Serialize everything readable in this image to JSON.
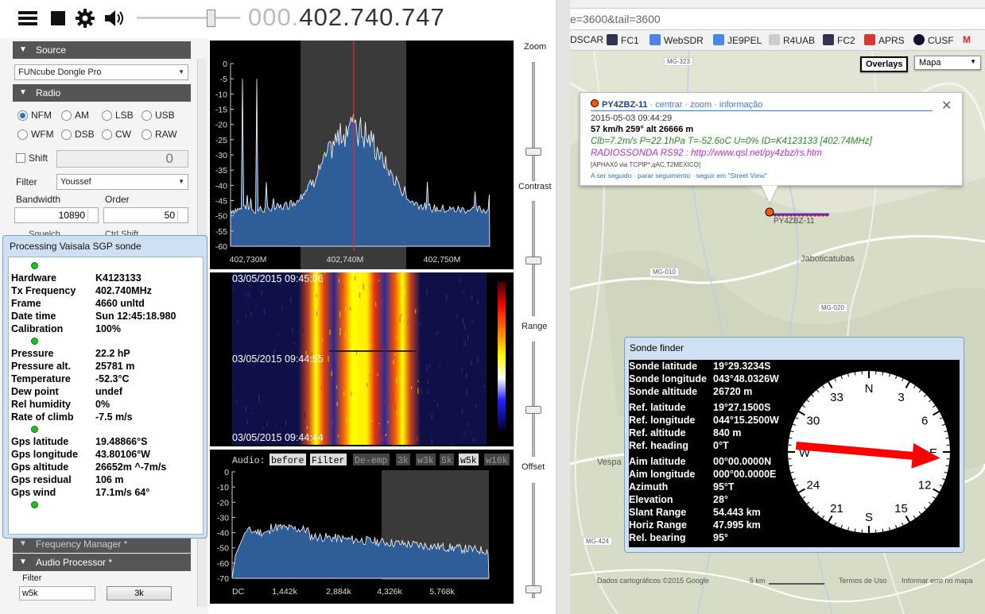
{
  "toolbar": {
    "freq_dim": "000.",
    "freq_main": "402.740.747",
    "icons": [
      "menu-icon",
      "stop-icon",
      "gear-icon",
      "speaker-icon"
    ]
  },
  "sidebar": {
    "source": {
      "title": "Source",
      "device": "FUNcube Dongle Pro"
    },
    "radio": {
      "title": "Radio",
      "modes": [
        "NFM",
        "AM",
        "LSB",
        "USB",
        "WFM",
        "DSB",
        "CW",
        "RAW"
      ],
      "selected": "NFM",
      "shift_label": "Shift",
      "shift_value": "0",
      "filter_label": "Filter",
      "filter_value": "Youssef",
      "bandwidth_label": "Bandwidth",
      "bandwidth_value": "10890",
      "order_label": "Order",
      "order_value": "50",
      "squelch_label": "Squelch",
      "ctcss_label": "Ctrl Shift"
    },
    "freq_manager": "Frequency Manager *",
    "audio_processor": {
      "title": "Audio Processor *",
      "filter_label": "Filter",
      "filter_value": "w5k",
      "button": "3k"
    }
  },
  "processing": {
    "title": "Processing Vaisala SGP sonde",
    "rows": [
      {
        "k": "Hardware",
        "v": "K4123133"
      },
      {
        "k": "Tx Frequency",
        "v": "402.740MHz"
      },
      {
        "k": "Frame",
        "v": "4660 unltd"
      },
      {
        "k": "Date time",
        "v": "Sun 12:45:18.980"
      },
      {
        "k": "Calibration",
        "v": "100%"
      },
      {
        "k": "Pressure",
        "v": "22.2 hP"
      },
      {
        "k": "Pressure alt.",
        "v": "25781 m"
      },
      {
        "k": "Temperature",
        "v": "-52.3°C"
      },
      {
        "k": "Dew point",
        "v": "undef"
      },
      {
        "k": "Rel humidity",
        "v": "0%"
      },
      {
        "k": "Rate of climb",
        "v": "-7.5 m/s"
      },
      {
        "k": "Gps latitude",
        "v": "19.48866°S"
      },
      {
        "k": "Gps longitude",
        "v": "43.80106°W"
      },
      {
        "k": "Gps altitude",
        "v": "26652m ^-7m/s"
      },
      {
        "k": "Gps residual",
        "v": "106 m"
      },
      {
        "k": "Gps wind",
        "v": "17.1m/s 64°"
      }
    ]
  },
  "spectrum": {
    "yticks": [
      "0",
      "-5",
      "-10",
      "-15",
      "-20",
      "-25",
      "-30",
      "-35",
      "-40",
      "-45",
      "-50",
      "-55",
      "-60"
    ],
    "xticks": [
      "402,730M",
      "402,740M",
      "402,750M"
    ]
  },
  "waterfall": {
    "times": [
      "03/05/2015 09:45:06",
      "03/05/2015 09:44:55",
      "03/05/2015 09:44:44"
    ]
  },
  "audio": {
    "label": "Audio:",
    "buttons": [
      "before",
      "Filter",
      "De-emp",
      "3k",
      "w3k",
      "5k",
      "w5k",
      "w10k"
    ],
    "yticks": [
      "0",
      "-10",
      "-20",
      "-30",
      "-40",
      "-50",
      "-60",
      "-70"
    ],
    "xticks": [
      "DC",
      "1,442k",
      "2,884k",
      "4,326k",
      "5,768k"
    ]
  },
  "sliders": {
    "zoom": "Zoom",
    "contrast": "Contrast",
    "range": "Range",
    "offset": "Offset"
  },
  "browser": {
    "url": "e=3600&tail=3600",
    "bookmarks": [
      "DSCAR",
      "FC1",
      "WebSDR",
      "JE9PEL",
      "R4UAB",
      "FC2",
      "APRS",
      "CUSF",
      "M"
    ],
    "overlays": "Overlays",
    "maptype": "Mapa",
    "roads": [
      "MG-323",
      "MG-010",
      "MG-020",
      "MG-424"
    ],
    "places": [
      "Jaboticatubas",
      "Vespa"
    ],
    "marker_label": "PY4ZBZ-11",
    "info": {
      "call": "PY4ZBZ-11",
      "links": "· centrar · zoom · informação",
      "time": "2015-05-03 09:44:29",
      "speed": "57 km/h 259° alt 26666 m",
      "telem": "Clb=7.2m/s P=22.1hPa T=-52.6oC U=0% ID=K4123133 [402.74MHz]",
      "comment": "RADIOSSONDA RS92 : http://www.qsl.net/py4zbz/rs.htm",
      "path": "[APHAX0 via TCPIP*,qAC,T2MEXICO]",
      "follow": "A ser seguido · parar seguimento · seguir em \"Street View\""
    },
    "footer": {
      "data": "Dados cartográficos ©2015 Google",
      "scale": "5 km",
      "terms": "Termos de Uso",
      "report": "Informar erro no mapa"
    }
  },
  "sonde_finder": {
    "title": "Sonde finder",
    "rows": [
      {
        "k": "Sonde latitude",
        "v": "19°29.3234S"
      },
      {
        "k": "Sonde longitude",
        "v": "043°48.0326W"
      },
      {
        "k": "Sonde altitude",
        "v": "26720 m"
      },
      {
        "k": "Ref. latitude",
        "v": "19°27.1500S"
      },
      {
        "k": "Ref. longitude",
        "v": "044°15.2500W"
      },
      {
        "k": "Ref. altitude",
        "v": "840 m"
      },
      {
        "k": "Ref. heading",
        "v": "0°T"
      },
      {
        "k": "Aim latitude",
        "v": "00°00.0000N"
      },
      {
        "k": "Aim longitude",
        "v": "000°00.0000E"
      },
      {
        "k": "Azimuth",
        "v": "95°T"
      },
      {
        "k": "Elevation",
        "v": "28°"
      },
      {
        "k": "Slant Range",
        "v": "54.443 km"
      },
      {
        "k": "Horiz Range",
        "v": "47.995 km"
      },
      {
        "k": "Rel. bearing",
        "v": "95°"
      }
    ],
    "compass": [
      "N",
      "3",
      "6",
      "E",
      "12",
      "15",
      "S",
      "21",
      "24",
      "W",
      "30",
      "33"
    ],
    "bearing_deg": 95
  },
  "colors": {
    "accent": "#2a6fc9",
    "section": "#555555",
    "spectrum_fill": "#3f6ea8",
    "arrow": "#ff0000",
    "track": "#2244ff"
  }
}
